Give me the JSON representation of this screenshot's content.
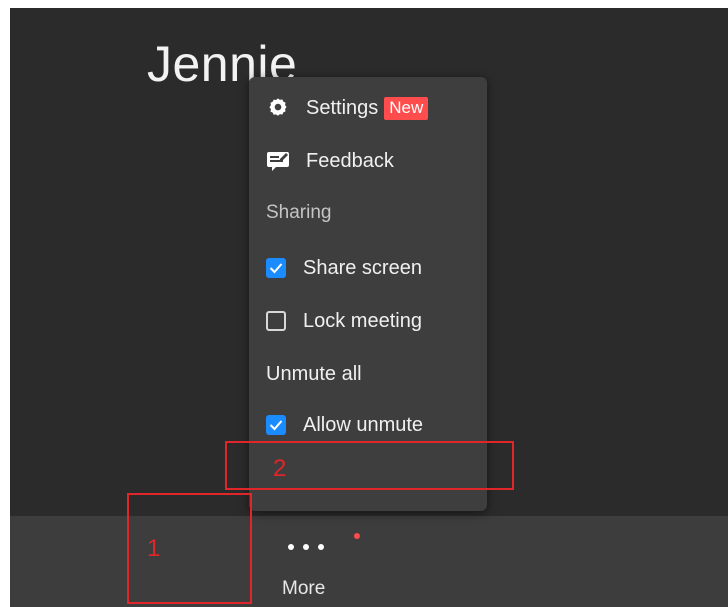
{
  "participant": {
    "name": "Jennie"
  },
  "menu": {
    "settings_label": "Settings",
    "settings_badge": "New",
    "feedback_label": "Feedback",
    "sharing_section": "Sharing",
    "share_screen_label": "Share screen",
    "share_screen_checked": true,
    "lock_meeting_label": "Lock meeting",
    "lock_meeting_checked": false,
    "unmute_all_label": "Unmute all",
    "allow_unmute_label": "Allow unmute",
    "allow_unmute_checked": true
  },
  "toolbar": {
    "more_label": "More"
  },
  "annotations": [
    {
      "label": "1"
    },
    {
      "label": "2"
    }
  ],
  "colors": {
    "accent": "#1a8cff",
    "badge": "#ff4d4d",
    "annotation": "#e0252b",
    "background": "#2b2b2b",
    "menu": "#3e3e3e",
    "toolbar": "#3d3d3d"
  },
  "icons": {
    "settings": "gear-icon",
    "feedback": "feedback-icon",
    "more": "more-dots-icon"
  }
}
